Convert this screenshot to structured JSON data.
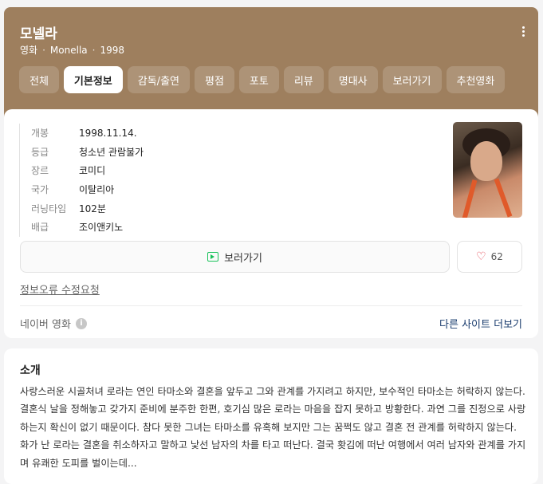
{
  "header": {
    "title": "모넬라",
    "subtitle": {
      "type": "영화",
      "original_title": "Monella",
      "year": "1998"
    },
    "tabs": [
      {
        "label": "전체",
        "active": false
      },
      {
        "label": "기본정보",
        "active": true
      },
      {
        "label": "감독/출연",
        "active": false
      },
      {
        "label": "평점",
        "active": false
      },
      {
        "label": "포토",
        "active": false
      },
      {
        "label": "리뷰",
        "active": false
      },
      {
        "label": "명대사",
        "active": false
      },
      {
        "label": "보러가기",
        "active": false
      },
      {
        "label": "추천영화",
        "active": false
      }
    ]
  },
  "info": {
    "rows": [
      {
        "key": "개봉",
        "value": "1998.11.14."
      },
      {
        "key": "등급",
        "value": "청소년 관람불가"
      },
      {
        "key": "장르",
        "value": "코미디"
      },
      {
        "key": "국가",
        "value": "이탈리아"
      },
      {
        "key": "러닝타임",
        "value": "102분"
      },
      {
        "key": "배급",
        "value": "조이앤키노"
      }
    ],
    "watch_label": "보러가기",
    "like_count": "62",
    "report_label": "정보오류 수정요청",
    "source_label": "네이버 영화",
    "more_label": "다른 사이트 더보기"
  },
  "intro": {
    "title": "소개",
    "text": "사랑스러운 시골처녀 로라는 연인 타마소와 결혼을 앞두고 그와 관계를 가지려고 하지만, 보수적인 타마소는 허락하지 않는다. 결혼식 날을 정해놓고 갖가지 준비에 분주한 한편, 호기심 많은 로라는 마음을 잡지 못하고 방황한다. 과연 그를 진정으로 사랑하는지 확신이 없기 때문이다. 참다 못한 그녀는 타마소를 유혹해 보지만 그는 꿈쩍도 않고 결혼 전 관계를 허락하지 않는다. 화가 난 로라는 결혼을 취소하자고 말하고 낯선 남자의 차를 타고 떠난다. 결국 홧김에 떠난 여행에서 여러 남자와 관계를 가지며 유쾌한 도피를 벌이는데..."
  },
  "colors": {
    "header_bg": "#9e7f5e",
    "accent_green": "#19c25b",
    "heart_red": "#e23d4a",
    "link_blue": "#1a3c6e"
  }
}
